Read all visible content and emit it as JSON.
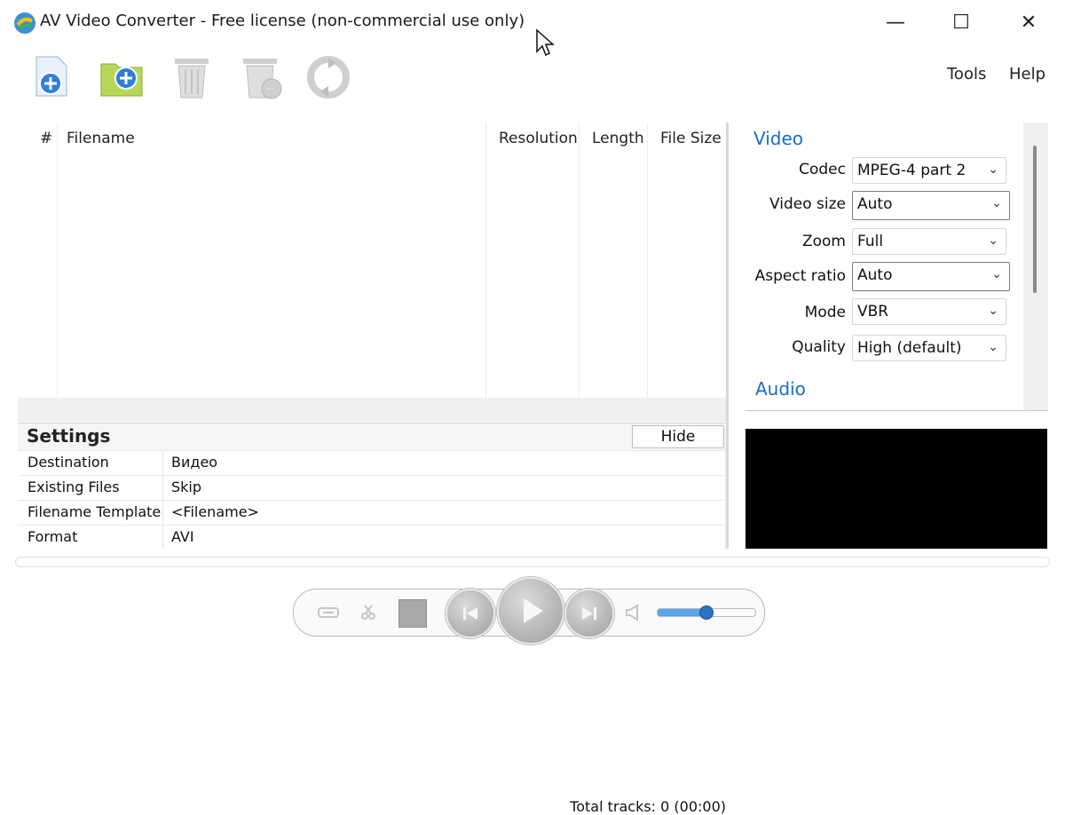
{
  "window": {
    "title": "AV Video Converter - Free license (non-commercial use only)",
    "controls": {
      "minimize": "—",
      "maximize": "☐",
      "close": "✕"
    }
  },
  "toolbar": {
    "buttons": [
      {
        "icon": "add-file-icon"
      },
      {
        "icon": "add-folder-icon"
      },
      {
        "icon": "delete-icon"
      },
      {
        "icon": "delete-all-icon"
      },
      {
        "icon": "convert-icon"
      }
    ],
    "menu": {
      "tools": "Tools",
      "help": "Help"
    }
  },
  "file_list": {
    "columns": [
      "#",
      "Filename",
      "Resolution",
      "Length",
      "File Size"
    ],
    "rows": [],
    "total": "Total tracks: 0 (00:00)"
  },
  "settings": {
    "title": "Settings",
    "hide_label": "Hide",
    "rows": [
      {
        "label": "Destination",
        "value": "Видео"
      },
      {
        "label": "Existing Files",
        "value": "Skip"
      },
      {
        "label": "Filename Template",
        "value": "<Filename>"
      },
      {
        "label": "Format",
        "value": "AVI"
      }
    ]
  },
  "properties": {
    "video_heading": "Video",
    "audio_heading": "Audio",
    "video": [
      {
        "label": "Codec",
        "value": "MPEG-4 part 2"
      },
      {
        "label": "Video size",
        "value": "Auto"
      },
      {
        "label": "Zoom",
        "value": "Full"
      },
      {
        "label": "Aspect ratio",
        "value": "Auto"
      },
      {
        "label": "Mode",
        "value": "VBR"
      },
      {
        "label": "Quality",
        "value": "High (default)"
      }
    ]
  },
  "player": {
    "volume_fraction": 0.5,
    "colors": {
      "volume_fill": "#5aa4ea",
      "accent": "#1a6cc4"
    }
  }
}
